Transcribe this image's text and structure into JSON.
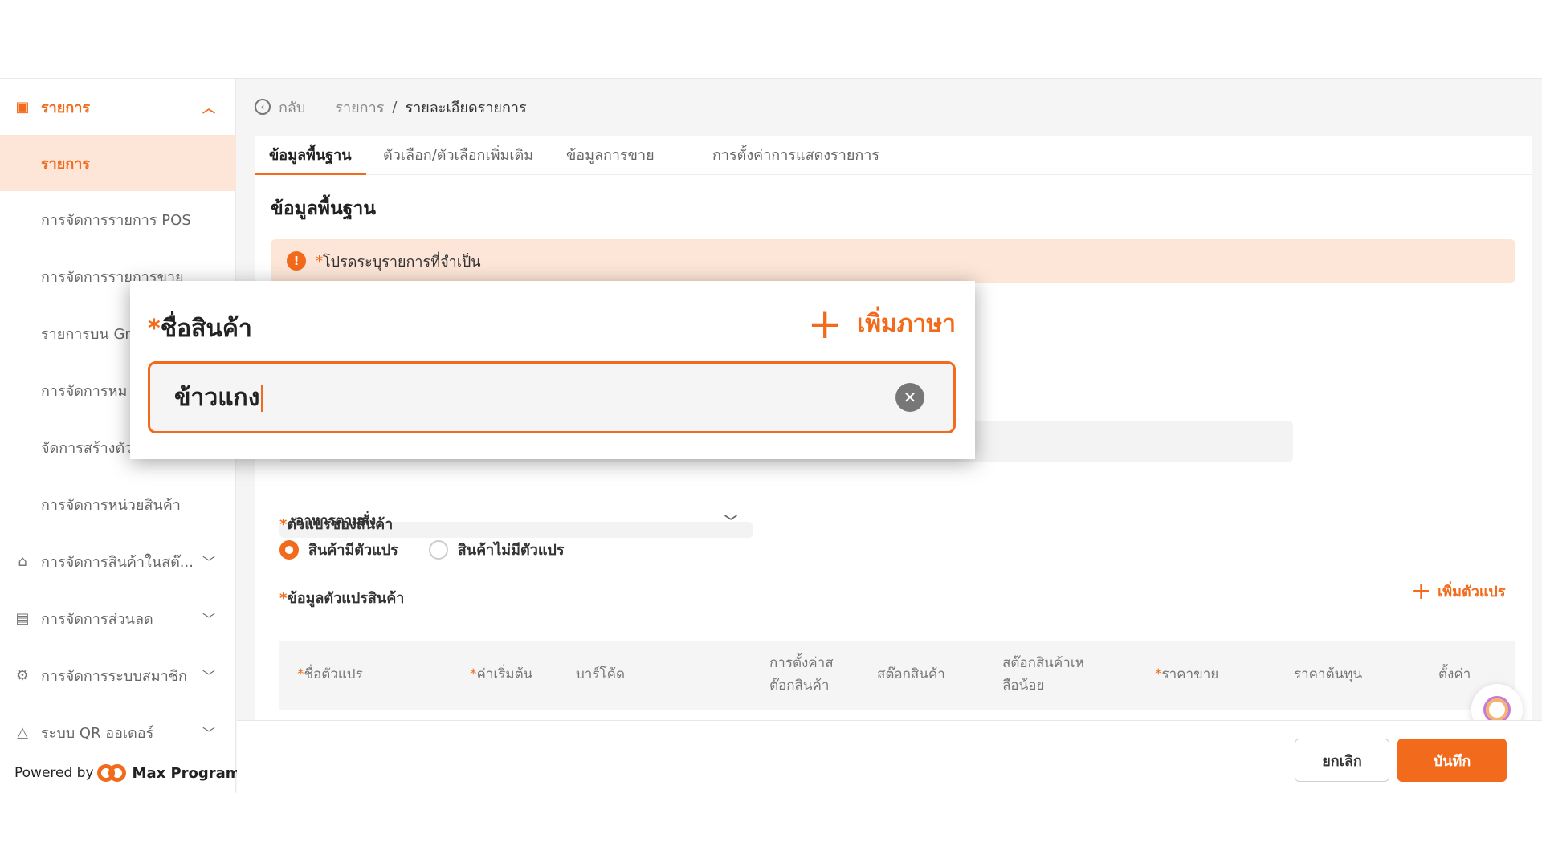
{
  "sidebar": {
    "items": [
      {
        "label": "รายการ",
        "icon": "list-icon"
      },
      {
        "label": "รายการ"
      },
      {
        "label": "การจัดการรายการ POS"
      },
      {
        "label": "การจัดการรายการขาย"
      },
      {
        "label": "รายการบน Gr"
      },
      {
        "label": "การจัดการหม"
      },
      {
        "label": "จัดการสร้างตัว"
      },
      {
        "label": "การจัดการหน่วยสินค้า"
      },
      {
        "label": "การจัดการสินค้าในสต๊...",
        "icon": "store-icon"
      },
      {
        "label": "การจัดการส่วนลด",
        "icon": "coupon-icon"
      },
      {
        "label": "การจัดการระบบสมาชิก",
        "icon": "member-icon"
      },
      {
        "label": "ระบบ QR ออเดอร์",
        "icon": "bell-icon"
      }
    ],
    "powered_by": "Powered by",
    "brand": "Max Program"
  },
  "breadcrumb": {
    "back": "กลับ",
    "parent": "รายการ",
    "separator": "/",
    "current": "รายละเอียดรายการ"
  },
  "tabs": [
    {
      "label": "ข้อมูลพื้นฐาน"
    },
    {
      "label": "ตัวเลือก/ตัวเลือกเพิ่มเติม"
    },
    {
      "label": "ข้อมูลการขาย"
    },
    {
      "label": "การตั้งค่าการแสดงรายการ"
    }
  ],
  "section_title": "ข้อมูลพื้นฐาน",
  "alert": {
    "text": "โปรดระบุรายการที่จำเป็น",
    "required_mark": "*"
  },
  "category_select": {
    "value": "อาหารตามสั่ง"
  },
  "variant_type": {
    "label": "ตัวแปรของสินค้า",
    "options": [
      "สินค้ามีตัวแปร",
      "สินค้าไม่มีตัวแปร"
    ],
    "selected": 0
  },
  "variant_data": {
    "label": "ข้อมูลตัวแปรสินค้า",
    "add_label": "เพิ่มตัวแปร"
  },
  "table": {
    "columns": [
      {
        "line1": "ชื่อตัวแปร",
        "required": true
      },
      {
        "line1": "ค่าเริ่มต้น",
        "required": true
      },
      {
        "line1": "บาร์โค้ด"
      },
      {
        "line1": "การตั้งค่าส",
        "line2": "ต๊อกสินค้า"
      },
      {
        "line1": "สต๊อกสินค้า"
      },
      {
        "line1": "สต๊อกสินค้าเห",
        "line2": "ลือน้อย"
      },
      {
        "line1": "ราคาขาย",
        "required": true
      },
      {
        "line1": "ราคาต้นทุน"
      },
      {
        "line1": "ตั้งค่า"
      }
    ]
  },
  "footer": {
    "cancel": "ยกเลิก",
    "save": "บันทึก"
  },
  "zoom": {
    "label": "ชื่อสินค้า",
    "add_language": "เพิ่มภาษา",
    "input_value": "ข้าวแกง"
  },
  "colors": {
    "accent": "#f26a1b",
    "accent_light": "#fde6d8"
  }
}
